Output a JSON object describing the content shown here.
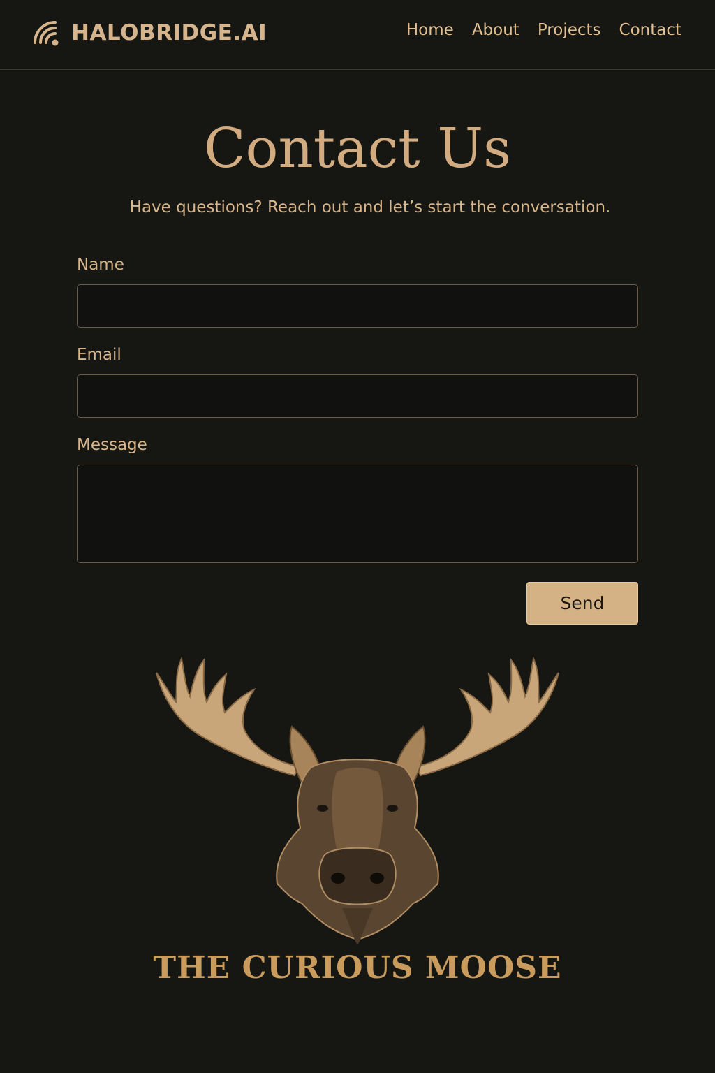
{
  "brand": {
    "name": "HALOBRIDGE.AI",
    "icon": "wifi-signal-icon"
  },
  "nav": {
    "items": [
      "Home",
      "About",
      "Projects",
      "Contact"
    ]
  },
  "hero": {
    "title": "Contact Us",
    "subtitle": "Have questions? Reach out and let’s start the conversation."
  },
  "form": {
    "name_label": "Name",
    "name_value": "",
    "email_label": "Email",
    "email_value": "",
    "message_label": "Message",
    "message_value": "",
    "send_label": "Send"
  },
  "footer": {
    "brand_text": "THE CURIOUS MOOSE",
    "illustration": "moose-head-illustration"
  },
  "colors": {
    "background": "#161613",
    "accent": "#d4b286",
    "text": "#d8b68c",
    "field_border": "#6b5a46",
    "button_text": "#1a1612"
  }
}
